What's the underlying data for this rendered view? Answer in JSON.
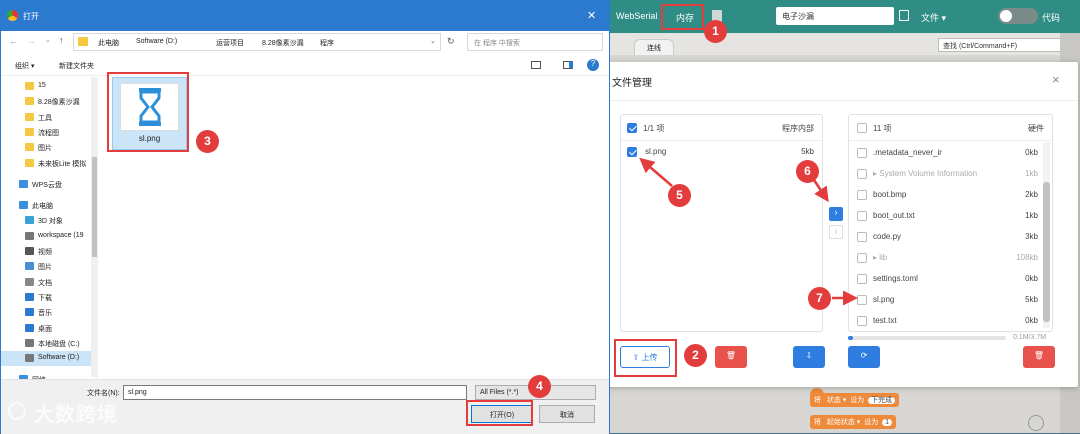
{
  "app": {
    "webserial_label": "WebSerial",
    "memory_label": "内存",
    "project_name": "电子沙漏",
    "file_menu": "文件 ▾",
    "code_label": "代码",
    "find_placeholder": "查找 (Ctrl/Command+F)",
    "tab_label": "连线",
    "blocks": [
      {
        "a": "将",
        "b": "状态 ▾",
        "c": "设为",
        "d": "下完成"
      },
      {
        "a": "将",
        "b": "起始状态 ▾",
        "c": "设为",
        "d": "1"
      }
    ]
  },
  "file_manager": {
    "title": "文件管理",
    "close": "×",
    "left": {
      "count": "1/1 项",
      "location": "程序内部",
      "files": [
        {
          "name": "sl.png",
          "size": "5kb",
          "checked": true
        }
      ]
    },
    "right": {
      "count": "11 项",
      "location": "硬件",
      "files": [
        {
          "name": ".metadata_never_ir",
          "size": "0kb",
          "dim": false
        },
        {
          "name": "▸ System Volume Information",
          "size": "1kb",
          "dim": true
        },
        {
          "name": "boot.bmp",
          "size": "2kb",
          "dim": false
        },
        {
          "name": "boot_out.txt",
          "size": "1kb",
          "dim": false
        },
        {
          "name": "code.py",
          "size": "3kb",
          "dim": false
        },
        {
          "name": "▸ lib",
          "size": "108kb",
          "dim": true
        },
        {
          "name": "settings.toml",
          "size": "0kb",
          "dim": false
        },
        {
          "name": "sl.png",
          "size": "5kb",
          "dim": false
        },
        {
          "name": "test.txt",
          "size": "0kb",
          "dim": false
        }
      ]
    },
    "upload_label": "⇪ 上传",
    "usage": "0.1M/3.7M",
    "usage_fraction": 0.03,
    "move_right": "›",
    "move_left": "‹",
    "colors": {
      "accent": "#2f7de1",
      "danger": "#e9524a"
    }
  },
  "open_dialog": {
    "title": "打开",
    "breadcrumb": [
      "此电脑",
      "Software (D:)",
      "运营项目",
      "8.28像素沙漏",
      "程序"
    ],
    "search_placeholder": "在 程序 中搜索",
    "toolbar": {
      "organize": "组织 ▾",
      "new_folder": "新建文件夹"
    },
    "sidebar": [
      {
        "label": "15",
        "kind": "folder",
        "indent": 1
      },
      {
        "label": "8.28像素沙漏",
        "kind": "folder",
        "indent": 1
      },
      {
        "label": "工具",
        "kind": "folder",
        "indent": 1
      },
      {
        "label": "流程图",
        "kind": "folder",
        "indent": 1
      },
      {
        "label": "图片",
        "kind": "folder",
        "indent": 1
      },
      {
        "label": "未来板Lite 模拟",
        "kind": "folder",
        "indent": 1
      },
      {
        "label": "",
        "kind": "gap",
        "indent": 0
      },
      {
        "label": "WPS云盘",
        "kind": "cloud",
        "indent": 0
      },
      {
        "label": "",
        "kind": "gap",
        "indent": 0
      },
      {
        "label": "此电脑",
        "kind": "pc",
        "indent": 0
      },
      {
        "label": "3D 对象",
        "kind": "obj",
        "indent": 1
      },
      {
        "label": "workspace (19",
        "kind": "drive",
        "indent": 1
      },
      {
        "label": "视频",
        "kind": "video",
        "indent": 1
      },
      {
        "label": "图片",
        "kind": "pic",
        "indent": 1
      },
      {
        "label": "文档",
        "kind": "doc",
        "indent": 1
      },
      {
        "label": "下载",
        "kind": "down",
        "indent": 1
      },
      {
        "label": "音乐",
        "kind": "music",
        "indent": 1
      },
      {
        "label": "桌面",
        "kind": "desk",
        "indent": 1
      },
      {
        "label": "本地磁盘 (C:)",
        "kind": "drive",
        "indent": 1
      },
      {
        "label": "Software (D:)",
        "kind": "drive",
        "indent": 1,
        "selected": true
      },
      {
        "label": "",
        "kind": "gap",
        "indent": 0
      },
      {
        "label": "网络",
        "kind": "net",
        "indent": 0
      }
    ],
    "file": {
      "name": "sl.png"
    },
    "filename_label": "文件名(N):",
    "filename_value": "sl.png",
    "filter_value": "All Files (*.*)",
    "open_label": "打开(O)",
    "cancel_label": "取消"
  },
  "annotations": [
    "1",
    "2",
    "3",
    "4",
    "5",
    "6",
    "7"
  ],
  "watermark": "大数跨境"
}
